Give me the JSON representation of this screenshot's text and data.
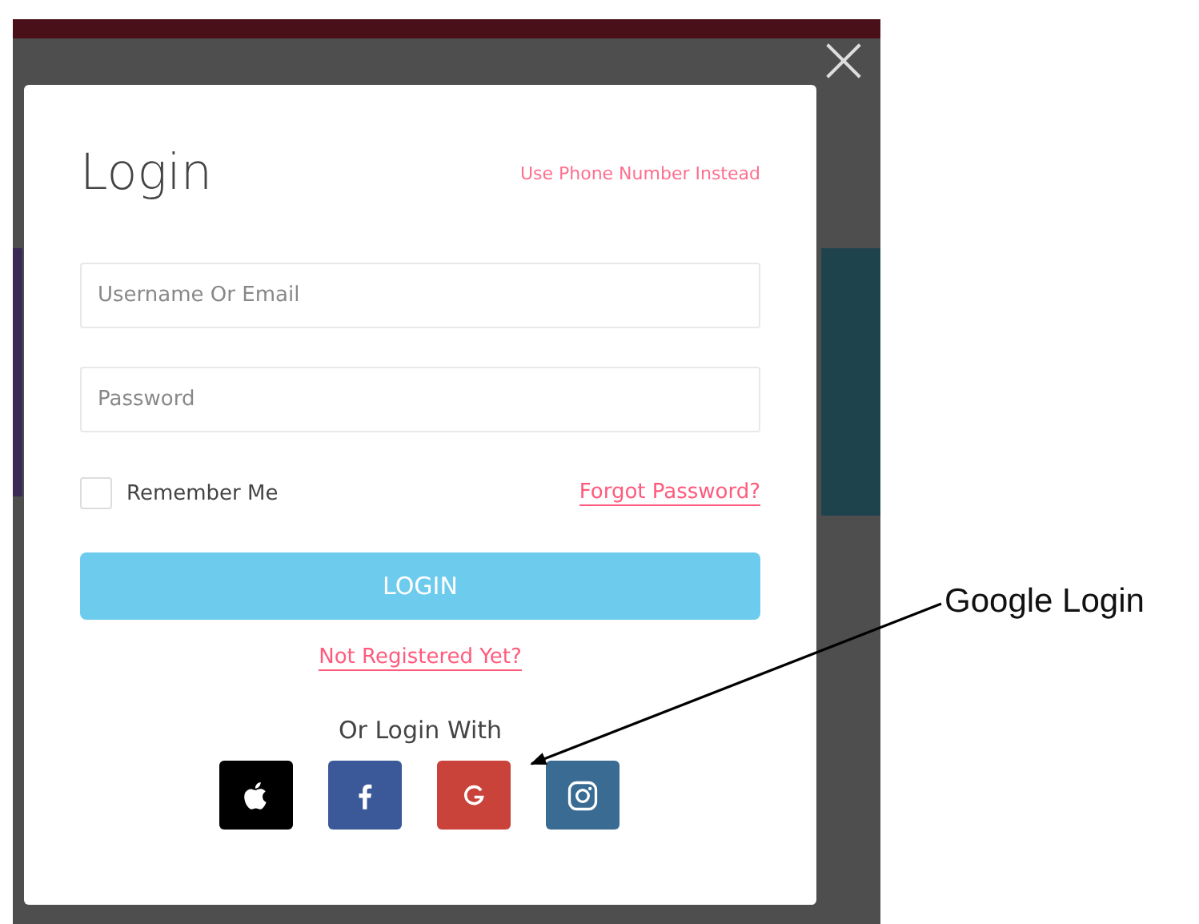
{
  "dialog": {
    "title": "Login",
    "alt_link": "Use Phone Number Instead",
    "fields": [
      {
        "placeholder": "Username Or Email"
      },
      {
        "placeholder": "Password"
      }
    ],
    "remember": {
      "label": "Remember Me",
      "checked": false
    },
    "forgot_link": "Forgot Password?",
    "submit": "LOGIN",
    "register_link": "Not Registered Yet?",
    "social_label": "Or Login With",
    "social_buttons": [
      {
        "kind": "apple",
        "color": "#000000"
      },
      {
        "kind": "facebook",
        "color": "#3b5998"
      },
      {
        "kind": "google",
        "color": "#c9433b"
      },
      {
        "kind": "instagram",
        "color": "#3a6b93"
      }
    ]
  },
  "annotation": {
    "label": "Google Login"
  }
}
